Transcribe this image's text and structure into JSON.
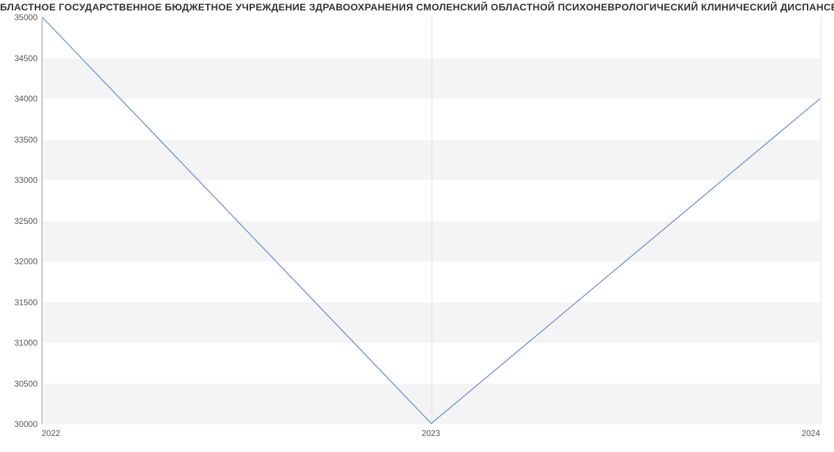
{
  "chart_data": {
    "type": "line",
    "title": "БЛАСТНОЕ ГОСУДАРСТВЕННОЕ БЮДЖЕТНОЕ УЧРЕЖДЕНИЕ ЗДРАВООХРАНЕНИЯ СМОЛЕНСКИЙ ОБЛАСТНОЙ ПСИХОНЕВРОЛОГИЧЕСКИЙ КЛИНИЧЕСКИЙ ДИСПАНСЕР | Данн",
    "categories": [
      "2022",
      "2023",
      "2024"
    ],
    "values": [
      35000,
      30000,
      34000
    ],
    "xlabel": "",
    "ylabel": "",
    "ylim": [
      30000,
      35000
    ],
    "yticks": [
      30000,
      30500,
      31000,
      31500,
      32000,
      32500,
      33000,
      33500,
      34000,
      34500,
      35000
    ],
    "line_color": "#7b97d4"
  }
}
